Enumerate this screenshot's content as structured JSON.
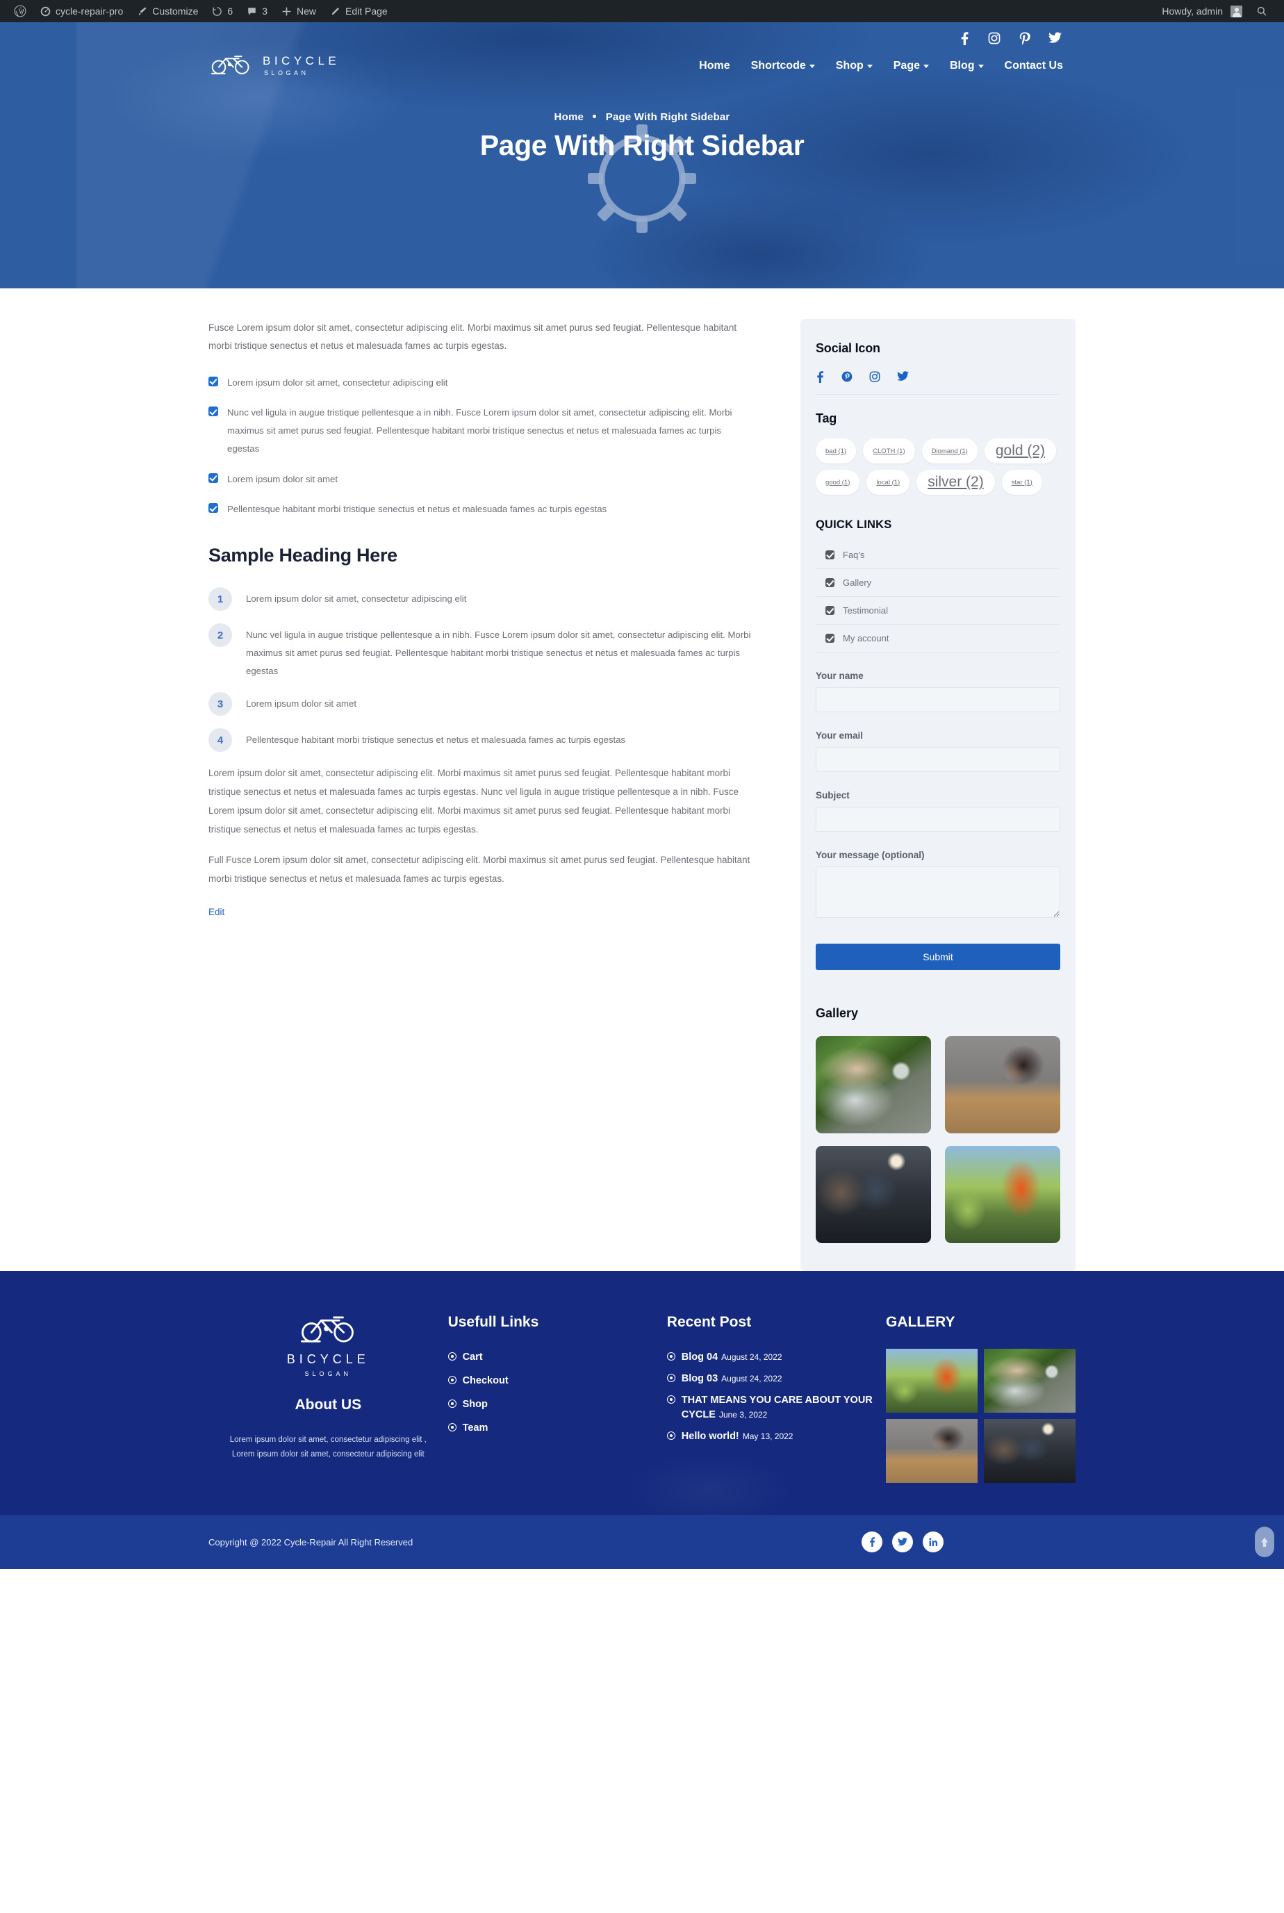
{
  "adminbar": {
    "site_name": "cycle-repair-pro",
    "customize": "Customize",
    "updates_count": "6",
    "comments_count": "3",
    "new": "New",
    "edit_page": "Edit Page",
    "howdy": "Howdy, admin"
  },
  "header": {
    "brand_name": "BICYCLE",
    "brand_slogan": "SLOGAN",
    "social": [
      "facebook-icon",
      "instagram-icon",
      "pinterest-icon",
      "twitter-icon"
    ],
    "menu": [
      {
        "label": "Home",
        "caret": false
      },
      {
        "label": "Shortcode",
        "caret": true
      },
      {
        "label": "Shop",
        "caret": true
      },
      {
        "label": "Page",
        "caret": true
      },
      {
        "label": "Blog",
        "caret": true
      },
      {
        "label": "Contact Us",
        "caret": false
      }
    ],
    "breadcrumb_home": "Home",
    "breadcrumb_current": "Page With Right Sidebar",
    "page_title": "Page With Right Sidebar"
  },
  "main": {
    "intro": "Fusce Lorem ipsum dolor sit amet, consectetur adipiscing elit. Morbi maximus sit amet purus sed feugiat. Pellentesque habitant morbi tristique senectus et netus et malesuada fames ac turpis egestas.",
    "checklist": [
      "Lorem ipsum dolor sit amet, consectetur adipiscing elit",
      "Nunc vel ligula in augue tristique pellentesque a in nibh. Fusce Lorem ipsum dolor sit amet, consectetur adipiscing elit. Morbi maximus sit amet purus sed feugiat. Pellentesque habitant morbi tristique senectus et netus et malesuada fames ac turpis egestas",
      "Lorem ipsum dolor sit amet",
      "Pellentesque habitant morbi tristique senectus et netus et malesuada fames ac turpis egestas"
    ],
    "heading": "Sample Heading Here",
    "numlist": [
      {
        "n": "1",
        "text": "Lorem ipsum dolor sit amet, consectetur adipiscing elit"
      },
      {
        "n": "2",
        "text": "Nunc vel ligula in augue tristique pellentesque a in nibh. Fusce Lorem ipsum dolor sit amet, consectetur adipiscing elit. Morbi maximus sit amet purus sed feugiat. Pellentesque habitant morbi tristique senectus et netus et malesuada fames ac turpis egestas"
      },
      {
        "n": "3",
        "text": "Lorem ipsum dolor sit amet"
      },
      {
        "n": "4",
        "text": "Pellentesque habitant morbi tristique senectus et netus et malesuada fames ac turpis egestas"
      }
    ],
    "para1": "Lorem ipsum dolor sit amet, consectetur adipiscing elit. Morbi maximus sit amet purus sed feugiat. Pellentesque habitant morbi tristique senectus et netus et malesuada fames ac turpis egestas. Nunc vel ligula in augue tristique pellentesque a in nibh. Fusce Lorem ipsum dolor sit amet, consectetur adipiscing elit. Morbi maximus sit amet purus sed feugiat. Pellentesque habitant morbi tristique senectus et netus et malesuada fames ac turpis egestas.",
    "para2": "Full Fusce Lorem ipsum dolor sit amet, consectetur adipiscing elit. Morbi maximus sit amet purus sed feugiat. Pellentesque habitant morbi tristique senectus et netus et malesuada fames ac turpis egestas.",
    "edit_link": "Edit"
  },
  "sidebar": {
    "social_title": "Social Icon",
    "social_icons": [
      "facebook-icon",
      "pinterest-icon",
      "instagram-icon",
      "twitter-icon"
    ],
    "tag_title": "Tag",
    "tags": [
      {
        "label": "bad (1)",
        "size": "s1"
      },
      {
        "label": "CLOTH (1)",
        "size": "s1"
      },
      {
        "label": "Diomand (1)",
        "size": "s1"
      },
      {
        "label": "gold (2)",
        "size": "s2"
      },
      {
        "label": "good (1)",
        "size": "s1"
      },
      {
        "label": "local (1)",
        "size": "s1"
      },
      {
        "label": "silver (2)",
        "size": "s2"
      },
      {
        "label": "star (1)",
        "size": "s1"
      }
    ],
    "quick_links_title": "QUICK LINKS",
    "quick_links": [
      "Faq's",
      "Gallery",
      "Testimonial",
      "My account"
    ],
    "form": {
      "name_label": "Your name",
      "name_value": "",
      "email_label": "Your email",
      "email_value": "",
      "subject_label": "Subject",
      "subject_value": "",
      "message_label": "Your message (optional)",
      "message_value": "",
      "submit_label": "Submit"
    },
    "gallery_title": "Gallery",
    "gallery": [
      "bike-mechanic-photo",
      "woman-at-laptop-photo",
      "team-meeting-photo",
      "gardener-photo"
    ]
  },
  "footer": {
    "brand_name": "BICYCLE",
    "brand_slogan": "SLOGAN",
    "about_title": "About US",
    "about_text": "Lorem ipsum dolor sit amet, consectetur adipiscing elit , Lorem ipsum dolor sit amet, consectetur adipiscing elit",
    "links_title": "Usefull Links",
    "links": [
      "Cart",
      "Checkout",
      "Shop",
      "Team"
    ],
    "recent_title": "Recent Post",
    "recent": [
      {
        "title": "Blog 04",
        "date": "August 24, 2022"
      },
      {
        "title": "Blog 03",
        "date": "August 24, 2022"
      },
      {
        "title": "THAT MEANS YOU CARE ABOUT YOUR CYCLE",
        "date": "June 3, 2022"
      },
      {
        "title": "Hello world!",
        "date": "May 13, 2022"
      }
    ],
    "gallery_title": "GALLERY",
    "gallery": [
      "gardener-photo",
      "bike-mechanic-photo",
      "woman-at-laptop-photo",
      "team-meeting-photo"
    ],
    "copyright": "Copyright @ 2022 Cycle-Repair All Right Reserved",
    "bottom_social": [
      "facebook-icon",
      "twitter-icon",
      "linkedin-icon"
    ]
  },
  "colors": {
    "admin_bar": "#1d2327",
    "accent_blue": "#1f60bd",
    "footer_blue": "#152a7e",
    "footer_bar_blue": "#1c3d93",
    "sidebar_bg": "#eff3f7"
  }
}
